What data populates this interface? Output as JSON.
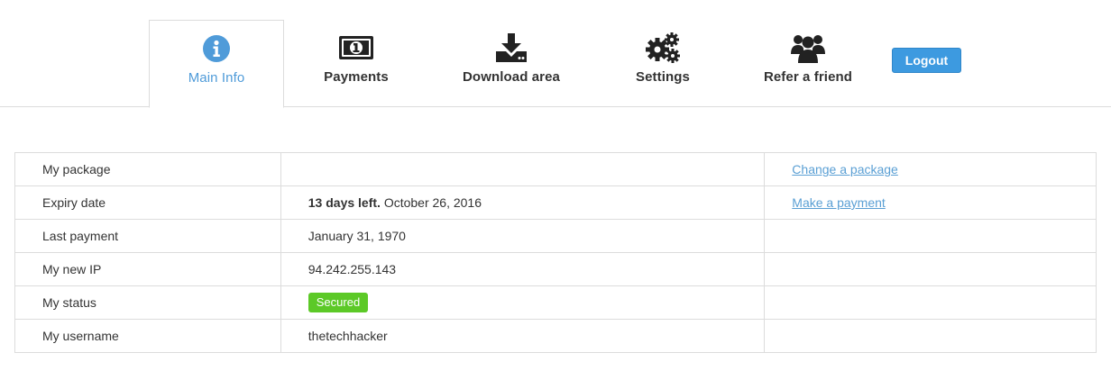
{
  "nav": {
    "tabs": [
      {
        "label": "Main Info",
        "icon": "info-circle-icon",
        "active": true
      },
      {
        "label": "Payments",
        "icon": "money-bill-icon"
      },
      {
        "label": "Download area",
        "icon": "download-icon"
      },
      {
        "label": "Settings",
        "icon": "gears-icon"
      },
      {
        "label": "Refer a friend",
        "icon": "users-icon"
      }
    ],
    "logout_label": "Logout"
  },
  "colors": {
    "accent": "#4f9bd9",
    "button": "#3d9ae0",
    "status_secured": "#5cc927",
    "link": "#5a9fd4",
    "border": "#dcdcdc"
  },
  "info": {
    "rows": [
      {
        "label": "My package",
        "value": "",
        "action": "Change a package"
      },
      {
        "label": "Expiry date",
        "value_bold": "13 days left.",
        "value": "October 26, 2016",
        "action": "Make a payment"
      },
      {
        "label": "Last payment",
        "value": "January 31, 1970"
      },
      {
        "label": "My new IP",
        "value": "94.242.255.143"
      },
      {
        "label": "My status",
        "value": "Secured"
      },
      {
        "label": "My username",
        "value": "thetechhacker"
      }
    ]
  }
}
